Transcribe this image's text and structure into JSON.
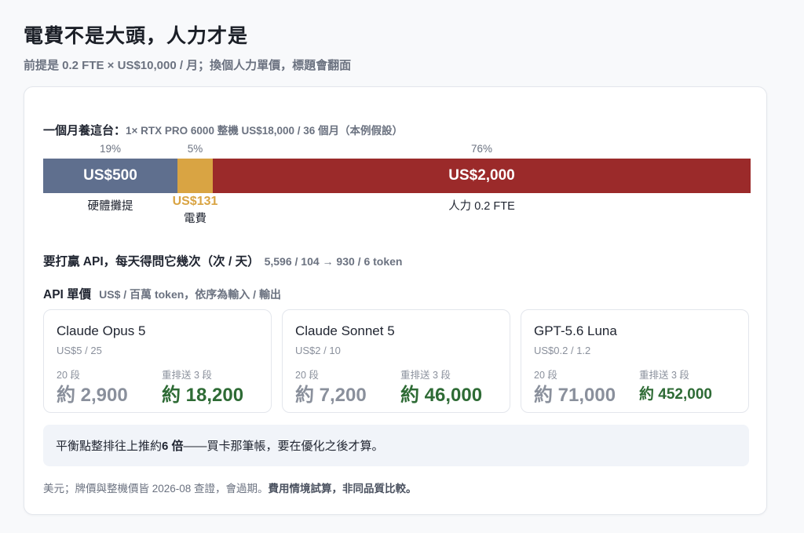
{
  "title": "電費不是大頭，人力才是",
  "subtitle": "前提是 0.2 FTE × US$10,000 / 月；換個人力單價，標題會翻面",
  "rig": {
    "heading": "一個月養這台：",
    "detail": "1× RTX PRO 6000 整機 US$18,000 / 36 個月（本例假設）"
  },
  "breakdown": {
    "segments": [
      {
        "pct": "19%",
        "value": "US$500",
        "label": "硬體攤提",
        "share": 0.19,
        "color": "#5f6f8e"
      },
      {
        "pct": "5%",
        "value": "US$131",
        "label": "電費",
        "share": 0.05,
        "color": "#d9a443"
      },
      {
        "pct": "76%",
        "value": "US$2,000",
        "label": "人力 0.2 FTE",
        "share": 0.76,
        "color": "#9b2a2a"
      }
    ]
  },
  "api_question": {
    "label": "要打贏 API，每天得問它幾次（次 / 天）",
    "detail": "5,596 / 104 → 930 / 6 token"
  },
  "pricing": {
    "label": "API 單價",
    "detail": "US$ / 百萬 token，依序為輸入 / 輸出"
  },
  "models": [
    {
      "name": "Claude Opus 5",
      "price": "US$5 / 25",
      "col1_label": "20 段",
      "col1_value": "約 2,900",
      "col2_label": "重排送 3 段",
      "col2_value": "約 18,200"
    },
    {
      "name": "Claude Sonnet 5",
      "price": "US$2 / 10",
      "col1_label": "20 段",
      "col1_value": "約 7,200",
      "col2_label": "重排送 3 段",
      "col2_value": "約 46,000"
    },
    {
      "name": "GPT-5.6 Luna",
      "price": "US$0.2 / 1.2",
      "col1_label": "20 段",
      "col1_value": "約 71,000",
      "col2_label": "重排送 3 段",
      "col2_value": "約 452,000"
    }
  ],
  "note": {
    "prefix": "平衡點整排往上推約 ",
    "emphasis": "6 倍",
    "suffix": "——買卡那筆帳，要在優化之後才算。"
  },
  "footer": {
    "normal": "美元；牌價與整機價皆 2026-08 查證，會過期。",
    "bold": "費用情境試算，非同品質比較。"
  },
  "colors": {
    "hardware": "#5f6f8e",
    "electricity": "#d9a443",
    "labor": "#9b2a2a",
    "green": "#2e6b35"
  }
}
